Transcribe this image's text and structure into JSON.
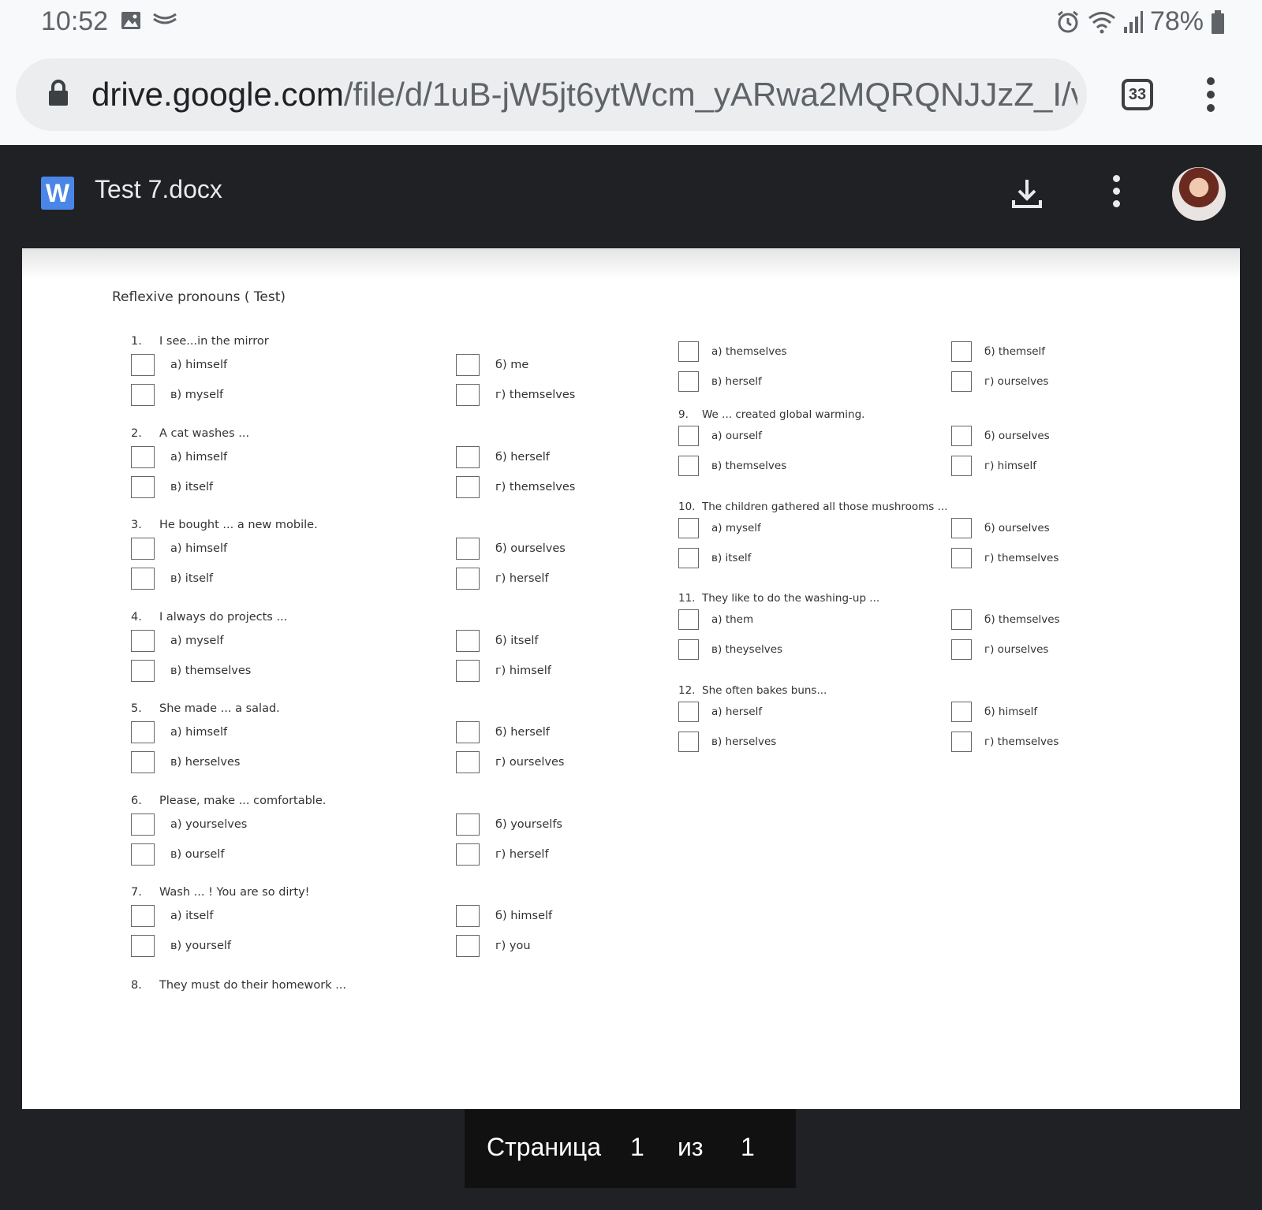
{
  "status_bar": {
    "time": "10:52",
    "battery": "78%",
    "icons": [
      "gallery-icon",
      "cast-icon",
      "alarm-icon",
      "wifi-icon",
      "signal-icon",
      "battery-icon"
    ]
  },
  "browser": {
    "url_host": "drive.google.com",
    "url_path": "/file/d/1uB-jW5jt6ytWcm_yARwa2MQRQNJJzZ_I/v",
    "tab_count": "33"
  },
  "viewer": {
    "app_icon_letter": "W",
    "title": "Test 7.docx"
  },
  "document": {
    "heading": "Reflexive pronouns ( Test)",
    "questions_left": [
      {
        "num": "1.",
        "text": "I see...in the mirror",
        "a": "а) himself",
        "b": "б) me",
        "c": "в) myself",
        "d": "г) themselves"
      },
      {
        "num": "2.",
        "text": "A cat washes ...",
        "a": "а) himself",
        "b": "б) herself",
        "c": "в) itself",
        "d": "г) themselves"
      },
      {
        "num": "3.",
        "text": "He bought ... a new mobile.",
        "a": "а) himself",
        "b": "б) ourselves",
        "c": "в) itself",
        "d": "г) herself"
      },
      {
        "num": "4.",
        "text": "I always do projects ...",
        "a": "а) myself",
        "b": "б) itself",
        "c": "в) themselves",
        "d": "г) himself"
      },
      {
        "num": "5.",
        "text": "She made ... a salad.",
        "a": "а) himself",
        "b": "б) herself",
        "c": "в) herselves",
        "d": "г) ourselves"
      },
      {
        "num": "6.",
        "text": "Please, make ... comfortable.",
        "a": "а) yourselves",
        "b": "б) yourselfs",
        "c": "в) ourself",
        "d": "г) herself"
      },
      {
        "num": "7.",
        "text": "Wash ... ! You are so dirty!",
        "a": "а) itself",
        "b": "б) himself",
        "c": "в) yourself",
        "d": "г) you"
      }
    ],
    "q8_left": {
      "num": "8.",
      "text": "They must do their homework ..."
    },
    "q8_options": {
      "a": "а) themselves",
      "b": "б) themself",
      "c": "в) herself",
      "d": "г) ourselves"
    },
    "questions_right": [
      {
        "num": "9.",
        "text": "We ... created global warming.",
        "a": "а) ourself",
        "b": "б) ourselves",
        "c": "в) themselves",
        "d": "г) himself"
      },
      {
        "num": "10.",
        "text": "The children gathered all those mushrooms ...",
        "a": "а) myself",
        "b": "б) ourselves",
        "c": "в) itself",
        "d": "г) themselves"
      },
      {
        "num": "11.",
        "text": "They like to do the washing-up ...",
        "a": "а) them",
        "b": "б) themselves",
        "c": "в) theyselves",
        "d": "г) ourselves"
      },
      {
        "num": "12.",
        "text": "She often bakes buns...",
        "a": "а) herself",
        "b": "б) himself",
        "c": "в) herselves",
        "d": "г) themselves"
      }
    ]
  },
  "pager": {
    "label": "Страница",
    "current": "1",
    "of": "из",
    "total": "1"
  }
}
